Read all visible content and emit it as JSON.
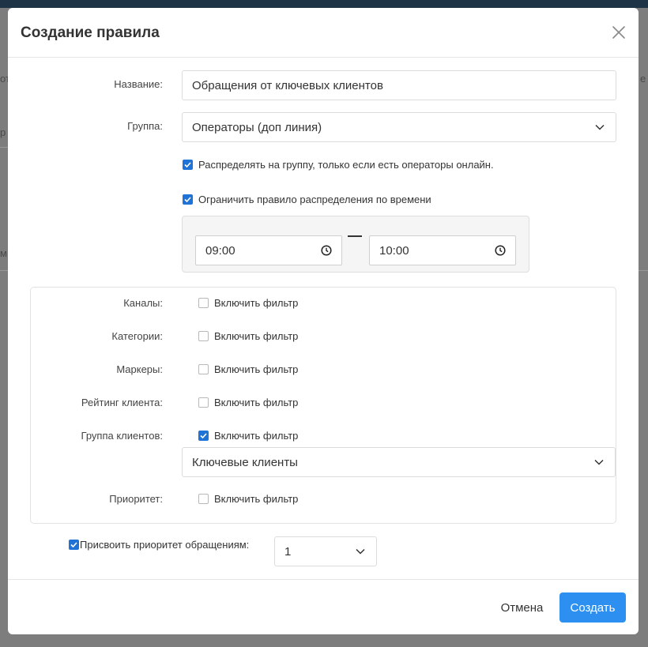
{
  "modal": {
    "title": "Создание правила",
    "name_label": "Название:",
    "name_value": "Обращения от ключевых клиентов",
    "group_label": "Группа:",
    "group_value": "Операторы (доп линия)",
    "distribute_online_label": "Распределять на группу, только если есть операторы онлайн.",
    "distribute_online_checked": true,
    "time_limit_label": "Ограничить правило распределения по времени",
    "time_limit_checked": true,
    "time_from": "09:00",
    "time_to": "10:00",
    "filters": [
      {
        "label": "Каналы:",
        "checkbox_label": "Включить фильтр",
        "checked": false
      },
      {
        "label": "Категории:",
        "checkbox_label": "Включить фильтр",
        "checked": false
      },
      {
        "label": "Маркеры:",
        "checkbox_label": "Включить фильтр",
        "checked": false
      },
      {
        "label": "Рейтинг клиента:",
        "checkbox_label": "Включить фильтр",
        "checked": false
      },
      {
        "label": "Группа клиентов:",
        "checkbox_label": "Включить фильтр",
        "checked": true
      },
      {
        "label": "Приоритет:",
        "checkbox_label": "Включить фильтр",
        "checked": false
      }
    ],
    "client_group_value": "Ключевые клиенты",
    "assign_priority_label": "Присвоить приоритет обращениям:",
    "assign_priority_checked": true,
    "priority_value": "1",
    "cancel_label": "Отмена",
    "create_label": "Создать"
  },
  "background": {
    "frag_1": "от",
    "frag_2": "р",
    "frag_3": "м",
    "frag_4": "е"
  },
  "colors": {
    "accent": "#2d8ff0",
    "checkbox": "#1f73d6"
  }
}
